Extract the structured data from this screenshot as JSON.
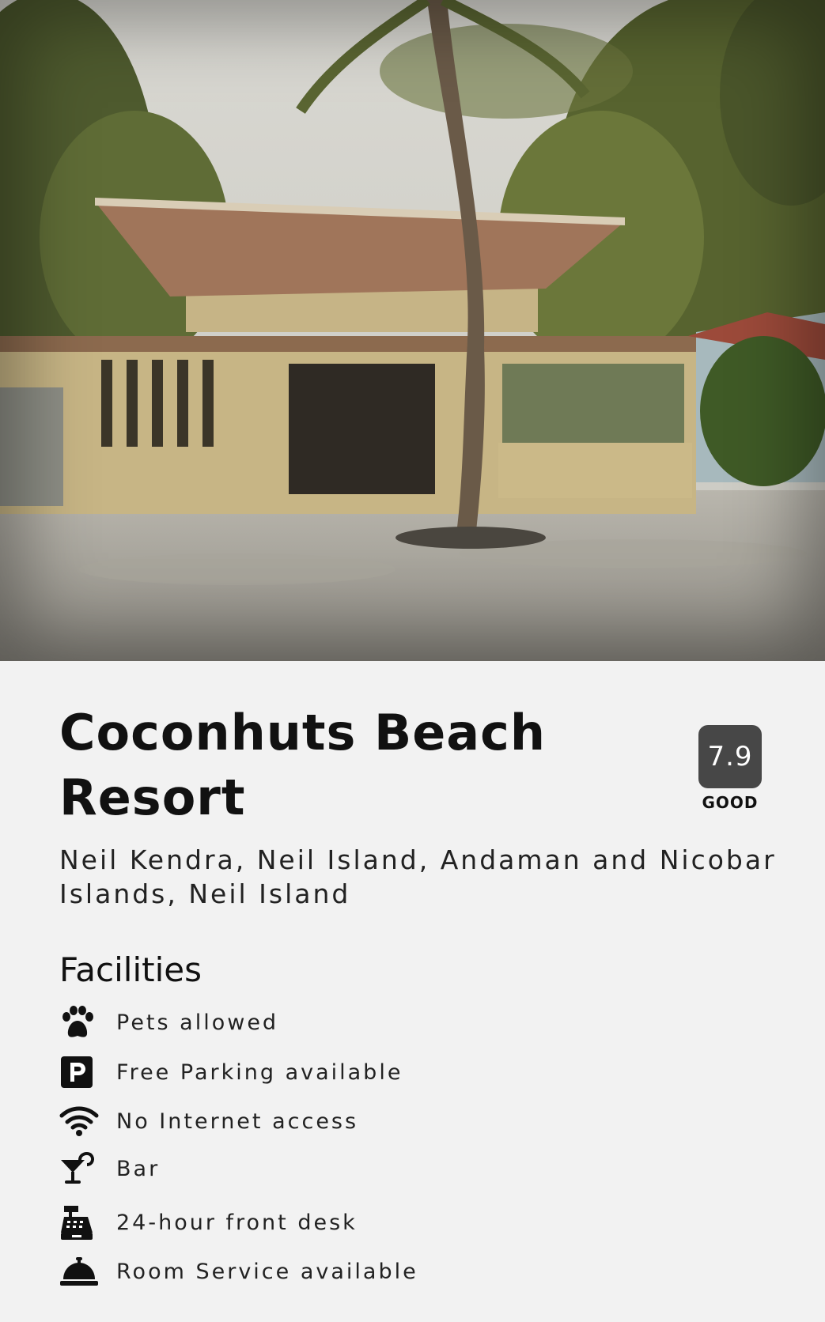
{
  "hotel": {
    "name": "Coconhuts Beach Resort",
    "address": "Neil Kendra, Neil Island, Andaman and Nicobar Islands, Neil Island",
    "rating": {
      "score": "7.9",
      "label": "GOOD"
    }
  },
  "facilities": {
    "heading": "Facilities",
    "items": [
      {
        "icon": "paw-icon",
        "label": "Pets allowed"
      },
      {
        "icon": "parking-icon",
        "label": "Free Parking available"
      },
      {
        "icon": "wifi-icon",
        "label": "No Internet access"
      },
      {
        "icon": "cocktail-icon",
        "label": "Bar"
      },
      {
        "icon": "cash-register-icon",
        "label": "24-hour front desk"
      },
      {
        "icon": "concierge-bell-icon",
        "label": "Room Service available"
      }
    ]
  }
}
